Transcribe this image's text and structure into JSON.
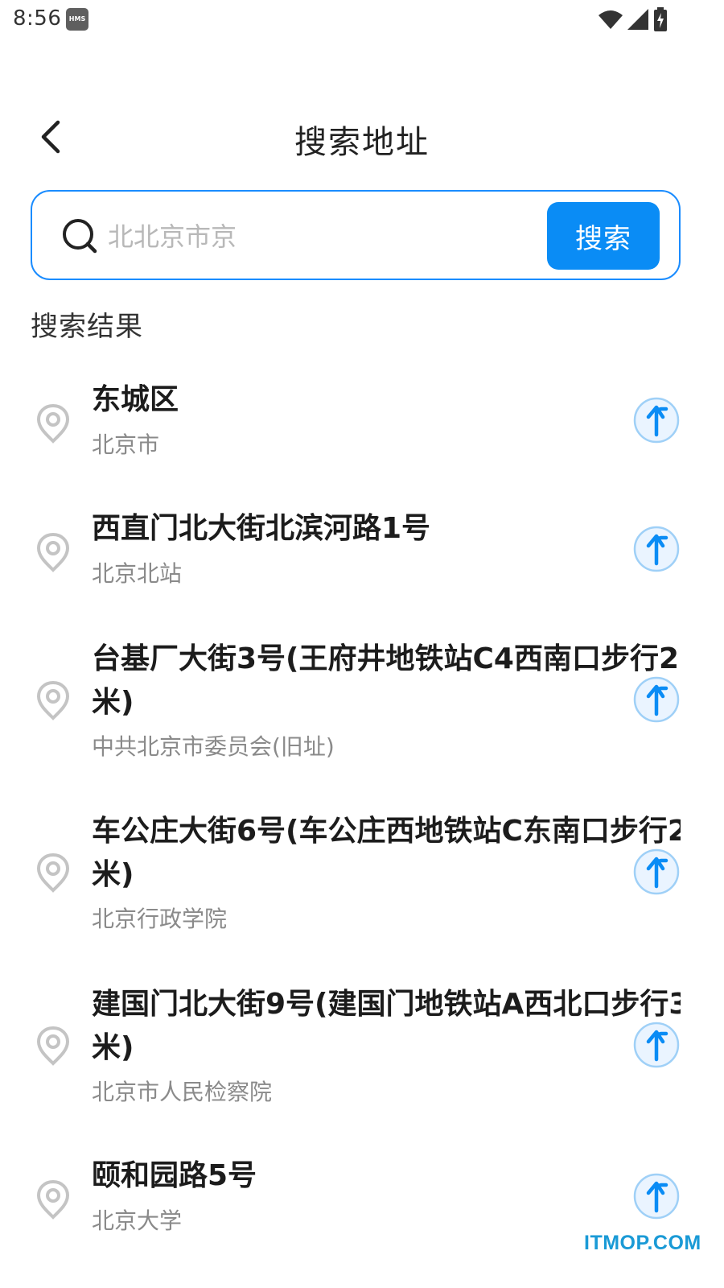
{
  "status_bar": {
    "time": "8:56",
    "badge": "HMS",
    "icons": [
      "wifi-icon",
      "cell-signal-icon",
      "battery-charging-icon"
    ]
  },
  "header": {
    "back_icon": "chevron-left-icon",
    "title": "搜索地址"
  },
  "search": {
    "icon": "search-icon",
    "placeholder": "北北京市京",
    "value": "",
    "button_label": "搜索",
    "accent_color": "#0a8cf5"
  },
  "results_label": "搜索结果",
  "results": [
    {
      "title_lines": [
        "东城区"
      ],
      "subtitle": "北京市",
      "pin_icon": "location-pin-icon",
      "nav_icon": "navigate-arrow-icon"
    },
    {
      "title_lines": [
        "西直门北大街北滨河路1号"
      ],
      "subtitle": "北京北站",
      "pin_icon": "location-pin-icon",
      "nav_icon": "navigate-arrow-icon"
    },
    {
      "title_lines": [
        "台基厂大街3号(王府井地铁站C4西南口步行2",
        "米)"
      ],
      "subtitle": "中共北京市委员会(旧址)",
      "pin_icon": "location-pin-icon",
      "nav_icon": "navigate-arrow-icon"
    },
    {
      "title_lines": [
        "车公庄大街6号(车公庄西地铁站C东南口步行2",
        "米)"
      ],
      "subtitle": "北京行政学院",
      "pin_icon": "location-pin-icon",
      "nav_icon": "navigate-arrow-icon"
    },
    {
      "title_lines": [
        "建国门北大街9号(建国门地铁站A西北口步行3",
        "米)"
      ],
      "subtitle": "北京市人民检察院",
      "pin_icon": "location-pin-icon",
      "nav_icon": "navigate-arrow-icon"
    },
    {
      "title_lines": [
        "颐和园路5号"
      ],
      "subtitle": "北京大学",
      "pin_icon": "location-pin-icon",
      "nav_icon": "navigate-arrow-icon"
    }
  ],
  "watermark": "ITMOP.COM"
}
